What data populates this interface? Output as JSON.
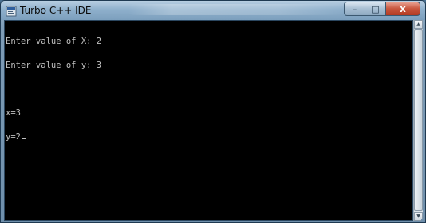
{
  "window": {
    "title": "Turbo C++ IDE",
    "controls": {
      "minimize": "–",
      "maximize": "□",
      "close": "x"
    }
  },
  "console": {
    "lines": [
      "Enter value of X: 2",
      "Enter value of y: 3",
      "",
      "x=3",
      "y=2"
    ]
  },
  "scrollbar": {
    "up": "▲",
    "down": "▼"
  },
  "colors": {
    "console_bg": "#000000",
    "console_text": "#c0c0c0",
    "close_button": "#c8553d"
  }
}
